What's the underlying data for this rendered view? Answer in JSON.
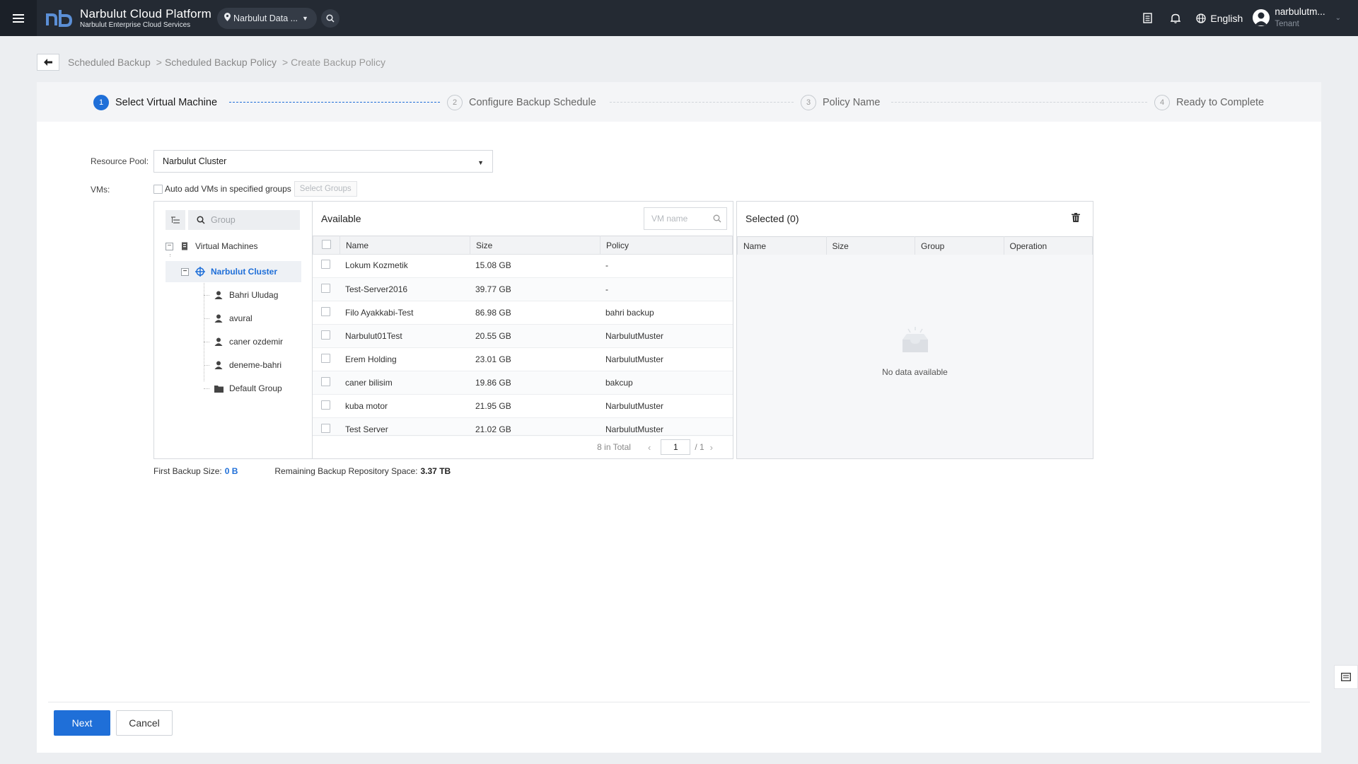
{
  "header": {
    "app_title": "Narbulut Cloud Platform",
    "app_subtitle": "Narbulut Enterprise Cloud Services",
    "datacenter": "Narbulut Data ...",
    "language": "English",
    "user_name": "narbulutm...",
    "user_role": "Tenant"
  },
  "breadcrumb": {
    "items": [
      "Scheduled Backup",
      "Scheduled Backup Policy",
      "Create Backup Policy"
    ],
    "separator": ">"
  },
  "steps": [
    {
      "num": "1",
      "label": "Select Virtual Machine"
    },
    {
      "num": "2",
      "label": "Configure Backup Schedule"
    },
    {
      "num": "3",
      "label": "Policy Name"
    },
    {
      "num": "4",
      "label": "Ready to Complete"
    }
  ],
  "form": {
    "resource_pool_label": "Resource Pool:",
    "resource_pool_value": "Narbulut Cluster",
    "vms_label": "VMs:",
    "auto_add_label": "Auto add VMs in specified groups",
    "select_groups_label": "Select Groups"
  },
  "tree": {
    "search_placeholder": "Group",
    "root": "Virtual Machines",
    "cluster": "Narbulut Cluster",
    "users": [
      "Bahri Uludag",
      "avural",
      "caner ozdemir",
      "deneme-bahri"
    ],
    "default_group": "Default Group"
  },
  "available": {
    "title": "Available",
    "search_placeholder": "VM name",
    "columns": [
      "Name",
      "Size",
      "Policy"
    ],
    "rows": [
      {
        "name": "Lokum Kozmetik",
        "size": "15.08 GB",
        "policy": "-"
      },
      {
        "name": "Test-Server2016",
        "size": "39.77 GB",
        "policy": "-"
      },
      {
        "name": "Filo Ayakkabi-Test",
        "size": "86.98 GB",
        "policy": "bahri backup"
      },
      {
        "name": "Narbulut01Test",
        "size": "20.55 GB",
        "policy": "NarbulutMuster"
      },
      {
        "name": "Erem Holding",
        "size": "23.01 GB",
        "policy": "NarbulutMuster"
      },
      {
        "name": "caner bilisim",
        "size": "19.86 GB",
        "policy": "bakcup"
      },
      {
        "name": "kuba motor",
        "size": "21.95 GB",
        "policy": "NarbulutMuster"
      },
      {
        "name": "Test Server",
        "size": "21.02 GB",
        "policy": "NarbulutMuster"
      }
    ],
    "pager": {
      "total": "8 in Total",
      "page": "1",
      "pages": "/ 1"
    }
  },
  "selected": {
    "title": "Selected (0)",
    "columns": [
      "Name",
      "Size",
      "Group",
      "Operation"
    ],
    "empty_text": "No data available"
  },
  "summary": {
    "first_backup_label": "First Backup Size:",
    "first_backup_value": "0 B",
    "remaining_label": "Remaining Backup Repository Space:",
    "remaining_value": "3.37 TB"
  },
  "footer": {
    "next_label": "Next",
    "cancel_label": "Cancel"
  },
  "colors": {
    "topbar": "#242a33",
    "accent": "#1f6fd8"
  }
}
